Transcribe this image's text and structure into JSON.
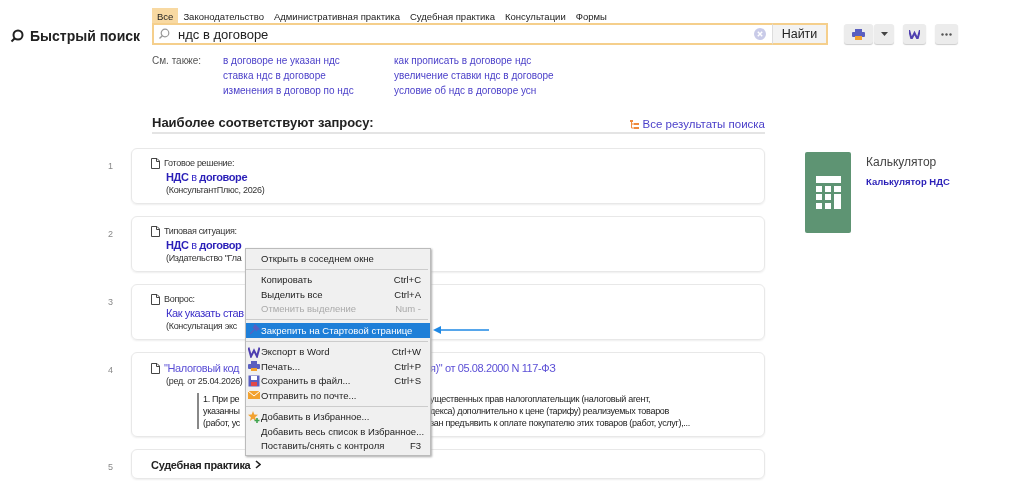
{
  "logo": {
    "title": "Быстрый поиск"
  },
  "tabs": [
    {
      "label": "Все",
      "selected": true
    },
    {
      "label": "Законодательство",
      "selected": false
    },
    {
      "label": "Административная практика",
      "selected": false
    },
    {
      "label": "Судебная практика",
      "selected": false
    },
    {
      "label": "Консультации",
      "selected": false
    },
    {
      "label": "Формы",
      "selected": false
    }
  ],
  "search": {
    "value": "ндс в договоре",
    "button": "Найти"
  },
  "see_also": {
    "label": "См. также:",
    "columns": [
      [
        "в договоре не указан ндс",
        "ставка ндс в договоре",
        "изменения в договор по ндс"
      ],
      [
        "как прописать в договоре ндс",
        "увеличение ставки ндс в договоре",
        "условие об ндс в договоре усн"
      ]
    ]
  },
  "results": {
    "heading": "Наиболее соответствуют запросу:",
    "all_link": "Все результаты поиска",
    "items": [
      {
        "kind": "doc",
        "number": "1",
        "category": "Готовое решение:",
        "title": "**НДС** в **договоре**",
        "source": "(КонсультантПлюс, 2026)"
      },
      {
        "kind": "doc",
        "number": "2",
        "category": "Типовая ситуация:",
        "title": "**НДС** в **договор**",
        "source": "(Издательство \"Гла"
      },
      {
        "kind": "doc",
        "number": "3",
        "category": "Вопрос:",
        "title": "Как указать став",
        "source": "(Консультация экс"
      },
      {
        "kind": "law",
        "number": "4",
        "title_parts": [
          "\"Налоговый код",
          "я)\" от 05.08.2000 N 117-ФЗ"
        ],
        "source": "(ред. от 25.04.2026)",
        "snippet": [
          [
            "1. При ре",
            "ущественных прав налогоплательщик (налоговый агент,"
          ],
          [
            "указанны",
            "декса) дополнительно к цене (тарифу) реализуемых товаров"
          ],
          [
            "(работ, ус",
            "зан предъявить к оплате покупателю этих товаров (работ, услуг),..."
          ]
        ]
      },
      {
        "kind": "section",
        "number": "5",
        "title": "Судебная практика"
      }
    ]
  },
  "calculator": {
    "title": "Калькулятор",
    "link": "Калькулятор НДС"
  },
  "context_menu": {
    "items": [
      {
        "kind": "plain",
        "label": "Открыть в соседнем окне",
        "disabled": false,
        "selected": false
      },
      {
        "kind": "separator"
      },
      {
        "kind": "plain",
        "label": "Копировать",
        "shortcut": "Ctrl+C",
        "disabled": false,
        "selected": false
      },
      {
        "kind": "plain",
        "label": "Выделить все",
        "shortcut": "Ctrl+A",
        "disabled": false,
        "selected": false
      },
      {
        "kind": "plain",
        "label": "Отменить выделение",
        "shortcut": "Num -",
        "disabled": true,
        "selected": false
      },
      {
        "kind": "separator"
      },
      {
        "kind": "pin",
        "label": "Закрепить на Стартовой странице",
        "disabled": false,
        "selected": true
      },
      {
        "kind": "separator"
      },
      {
        "kind": "word",
        "label": "Экспорт в Word",
        "shortcut": "Ctrl+W",
        "disabled": false,
        "selected": false
      },
      {
        "kind": "print",
        "label": "Печать...",
        "shortcut": "Ctrl+P",
        "disabled": false,
        "selected": false
      },
      {
        "kind": "save",
        "label": "Сохранить в файл...",
        "shortcut": "Ctrl+S",
        "disabled": false,
        "selected": false
      },
      {
        "kind": "mail",
        "label": "Отправить по почте...",
        "disabled": false,
        "selected": false
      },
      {
        "kind": "separator"
      },
      {
        "kind": "star",
        "label": "Добавить в Избранное...",
        "disabled": false,
        "selected": false
      },
      {
        "kind": "plain",
        "label": "Добавить весь список в Избранное...",
        "disabled": false,
        "selected": false
      },
      {
        "kind": "plain",
        "label": "Поставить/снять с контроля",
        "shortcut": "F3",
        "disabled": false,
        "selected": false
      }
    ]
  }
}
